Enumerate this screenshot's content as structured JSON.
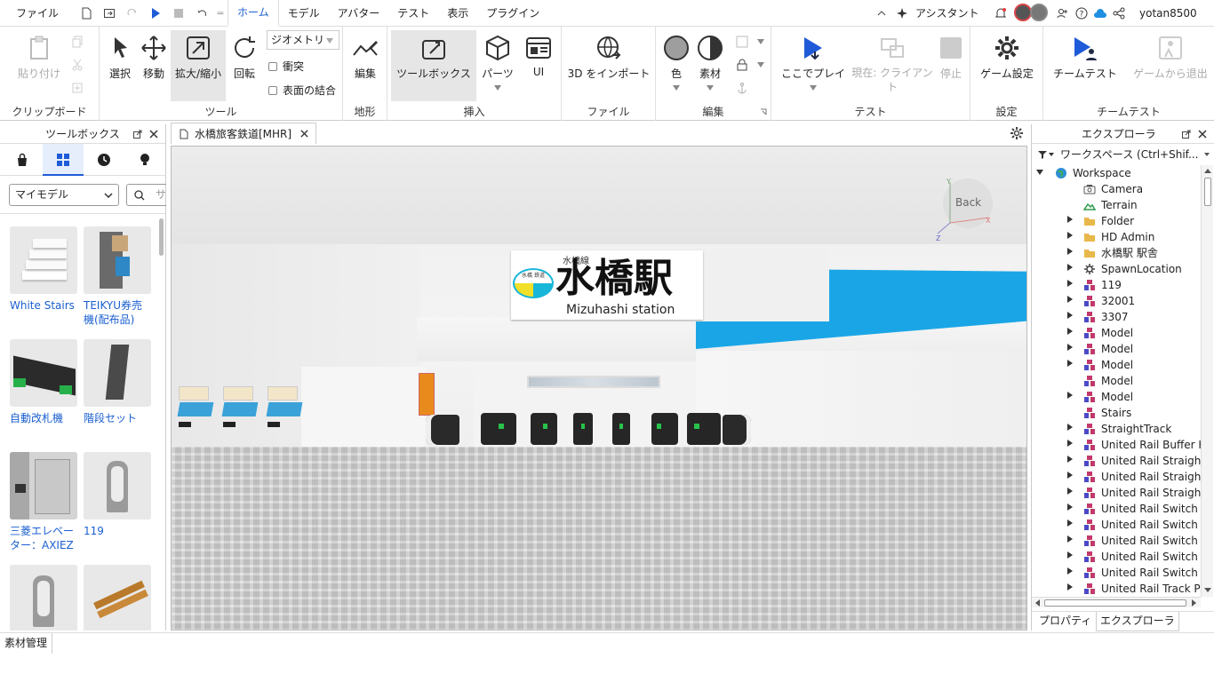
{
  "menubar": {
    "items": [
      "ファイル",
      "ホーム",
      "モデル",
      "アバター",
      "テスト",
      "表示",
      "プラグイン"
    ],
    "active_index": 1,
    "assistant": "アシスタント",
    "username": "yotan8500"
  },
  "ribbon": {
    "clipboard": {
      "paste": "貼り付け",
      "group": "クリップボード"
    },
    "tools": {
      "select": "選択",
      "move": "移動",
      "scale": "拡大/縮小",
      "rotate": "回転",
      "geometry": "ジオメトリ",
      "collide": "衝突",
      "join": "表面の結合",
      "group": "ツール"
    },
    "terrain": {
      "edit": "編集",
      "group": "地形"
    },
    "insert": {
      "toolbox": "ツールボックス",
      "parts": "パーツ",
      "ui": "UI",
      "group": "挿入"
    },
    "file": {
      "import3d": "3D をインポート",
      "group": "ファイル"
    },
    "edit": {
      "color": "色",
      "material": "素材",
      "group": "編集"
    },
    "test": {
      "play_here": "ここでプレイ",
      "current": "現在: クライアント",
      "stop": "停止",
      "group": "テスト"
    },
    "settings": {
      "game": "ゲーム設定",
      "group": "設定"
    },
    "teamtest": {
      "team": "チームテスト",
      "exit": "ゲームから退出",
      "group": "チームテスト"
    }
  },
  "toolbox": {
    "title": "ツールボックス",
    "dropdown": "マイモデル",
    "search_placeholder": "サ",
    "items": [
      {
        "label": "White Stairs"
      },
      {
        "label": "TEIKYU券売機(配布品)"
      },
      {
        "label": "自動改札機"
      },
      {
        "label": "階段セット"
      },
      {
        "label": "三菱エレベーター：AXIEZ"
      },
      {
        "label": "119"
      },
      {
        "label": ""
      },
      {
        "label": ""
      }
    ]
  },
  "document_tab": {
    "title": "水橋旅客鉄道[MHR]"
  },
  "viewport": {
    "sign_line": "水橋線",
    "sign_title": "水橋駅",
    "sign_en": "Mizuhashi station",
    "sign_logo": "水橋 鉄道",
    "back": "Back"
  },
  "explorer": {
    "title": "エクスプローラ",
    "filter_placeholder": "ワークスペース (Ctrl+Shif...",
    "items": [
      {
        "label": "Workspace",
        "icon": "globe-icon",
        "depth": 0,
        "expanded": true
      },
      {
        "label": "Camera",
        "icon": "camera-icon",
        "depth": 1
      },
      {
        "label": "Terrain",
        "icon": "terrain-icon",
        "depth": 1
      },
      {
        "label": "Folder",
        "icon": "folder-icon",
        "depth": 1,
        "arrow": true
      },
      {
        "label": "HD Admin",
        "icon": "folder-icon",
        "depth": 1,
        "arrow": true
      },
      {
        "label": "水橋駅 駅舎",
        "icon": "folder-icon",
        "depth": 1,
        "arrow": true
      },
      {
        "label": "SpawnLocation",
        "icon": "spawn-icon",
        "depth": 1,
        "arrow": true
      },
      {
        "label": "119",
        "icon": "model-icon",
        "depth": 1,
        "arrow": true
      },
      {
        "label": "32001",
        "icon": "model-icon",
        "depth": 1,
        "arrow": true
      },
      {
        "label": "3307",
        "icon": "model-icon",
        "depth": 1,
        "arrow": true
      },
      {
        "label": "Model",
        "icon": "model-icon",
        "depth": 1,
        "arrow": true
      },
      {
        "label": "Model",
        "icon": "model-icon",
        "depth": 1,
        "arrow": true
      },
      {
        "label": "Model",
        "icon": "model-icon",
        "depth": 1,
        "arrow": true
      },
      {
        "label": "Model",
        "icon": "model-icon",
        "depth": 1
      },
      {
        "label": "Model",
        "icon": "model-icon",
        "depth": 1,
        "arrow": true
      },
      {
        "label": "Stairs",
        "icon": "model-icon",
        "depth": 1
      },
      {
        "label": "StraightTrack",
        "icon": "model-icon",
        "depth": 1,
        "arrow": true
      },
      {
        "label": "United Rail Buffer Hay",
        "icon": "model-icon",
        "depth": 1,
        "arrow": true
      },
      {
        "label": "United Rail Straight Lo",
        "icon": "model-icon",
        "depth": 1,
        "arrow": true
      },
      {
        "label": "United Rail Straight Lo",
        "icon": "model-icon",
        "depth": 1,
        "arrow": true
      },
      {
        "label": "United Rail Straight M",
        "icon": "model-icon",
        "depth": 1,
        "arrow": true
      },
      {
        "label": "United Rail Switch Cro",
        "icon": "model-icon",
        "depth": 1,
        "arrow": true
      },
      {
        "label": "United Rail Switch Cro",
        "icon": "model-icon",
        "depth": 1,
        "arrow": true
      },
      {
        "label": "United Rail Switch Cro",
        "icon": "model-icon",
        "depth": 1,
        "arrow": true
      },
      {
        "label": "United Rail Switch SBe",
        "icon": "model-icon",
        "depth": 1,
        "arrow": true
      },
      {
        "label": "United Rail Switch SBe",
        "icon": "model-icon",
        "depth": 1,
        "arrow": true
      },
      {
        "label": "United Rail Track Pack",
        "icon": "model-icon",
        "depth": 1,
        "arrow": true
      }
    ],
    "tabs": [
      "プロパティ",
      "エクスプローラ"
    ]
  },
  "statusbar": {
    "tab": "素材管理"
  }
}
